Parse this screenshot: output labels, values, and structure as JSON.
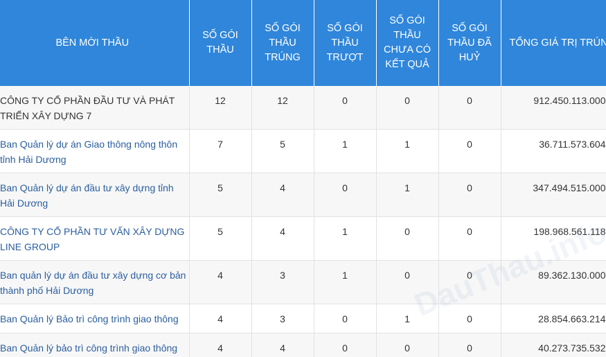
{
  "headers": [
    "BÊN MỜI THẦU",
    "SỐ GÓI THẦU",
    "SỐ GÓI THẦU TRÚNG",
    "SỐ GÓI THẦU TRƯỢT",
    "SỐ GÓI THẦU CHƯA CÓ KẾT QUẢ",
    "SỐ GÓI THẦU ĐÃ HUỶ",
    "TỔNG GIÁ TRỊ TRÚNG"
  ],
  "rows": [
    {
      "name": "CÔNG TY CỔ PHẦN ĐẦU TƯ VÀ PHÁT TRIỂN XÂY DỰNG 7",
      "link": false,
      "total": "12",
      "won": "12",
      "lost": "0",
      "pending": "0",
      "cancelled": "0",
      "value": "912.450.113.000"
    },
    {
      "name": "Ban Quản lý dự án Giao thông nông thôn tỉnh Hải Dương",
      "link": true,
      "total": "7",
      "won": "5",
      "lost": "1",
      "pending": "1",
      "cancelled": "0",
      "value": "36.711.573.604"
    },
    {
      "name": "Ban Quản lý dự án đầu tư xây dựng tỉnh Hải Dương",
      "link": true,
      "total": "5",
      "won": "4",
      "lost": "0",
      "pending": "1",
      "cancelled": "0",
      "value": "347.494.515.000"
    },
    {
      "name": "CÔNG TY CỔ PHẦN TƯ VẤN XÂY DỰNG LINE GROUP",
      "link": true,
      "total": "5",
      "won": "4",
      "lost": "1",
      "pending": "0",
      "cancelled": "0",
      "value": "198.968.561.118"
    },
    {
      "name": "Ban quản lý dự án đầu tư xây dựng cơ bản thành phố Hải Dương",
      "link": true,
      "total": "4",
      "won": "3",
      "lost": "1",
      "pending": "0",
      "cancelled": "0",
      "value": "89.362.130.000"
    },
    {
      "name": "Ban Quản lý Bảo trì công trình giao thông",
      "link": true,
      "total": "4",
      "won": "3",
      "lost": "0",
      "pending": "1",
      "cancelled": "0",
      "value": "28.854.663.214"
    },
    {
      "name": "Ban Quản lý bảo trì công trình giao thông",
      "link": true,
      "total": "4",
      "won": "4",
      "lost": "0",
      "pending": "0",
      "cancelled": "0",
      "value": "40.273.735.532"
    }
  ],
  "watermark": "DauThau.info",
  "colors": {
    "header_bg": "#2f86da",
    "header_text": "#ffffff",
    "link": "#2b5e9e",
    "row_alt": "#f7f7f7"
  }
}
